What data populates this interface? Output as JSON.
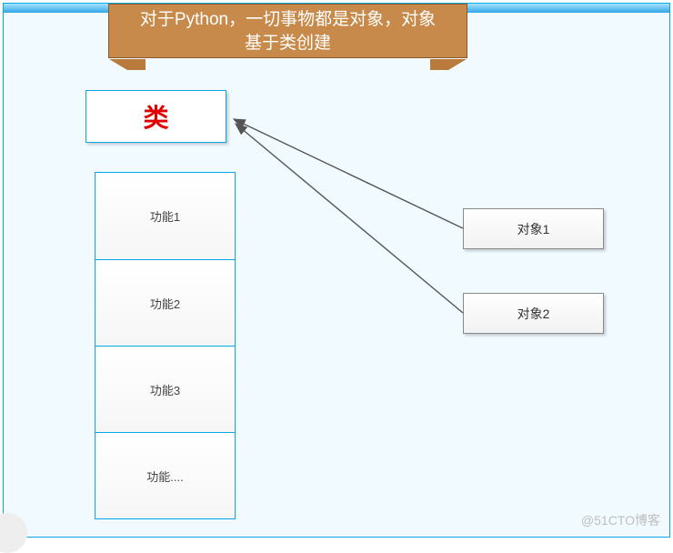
{
  "banner": {
    "text": "对于Python，一切事物都是对象，对象基于类创建"
  },
  "class_box": {
    "label": "类"
  },
  "functions": {
    "items": [
      {
        "label": "功能1"
      },
      {
        "label": "功能2"
      },
      {
        "label": "功能3"
      },
      {
        "label": "功能...."
      }
    ]
  },
  "objects": {
    "obj1": {
      "label": "对象1"
    },
    "obj2": {
      "label": "对象2"
    }
  },
  "watermark": "@51CTO博客"
}
